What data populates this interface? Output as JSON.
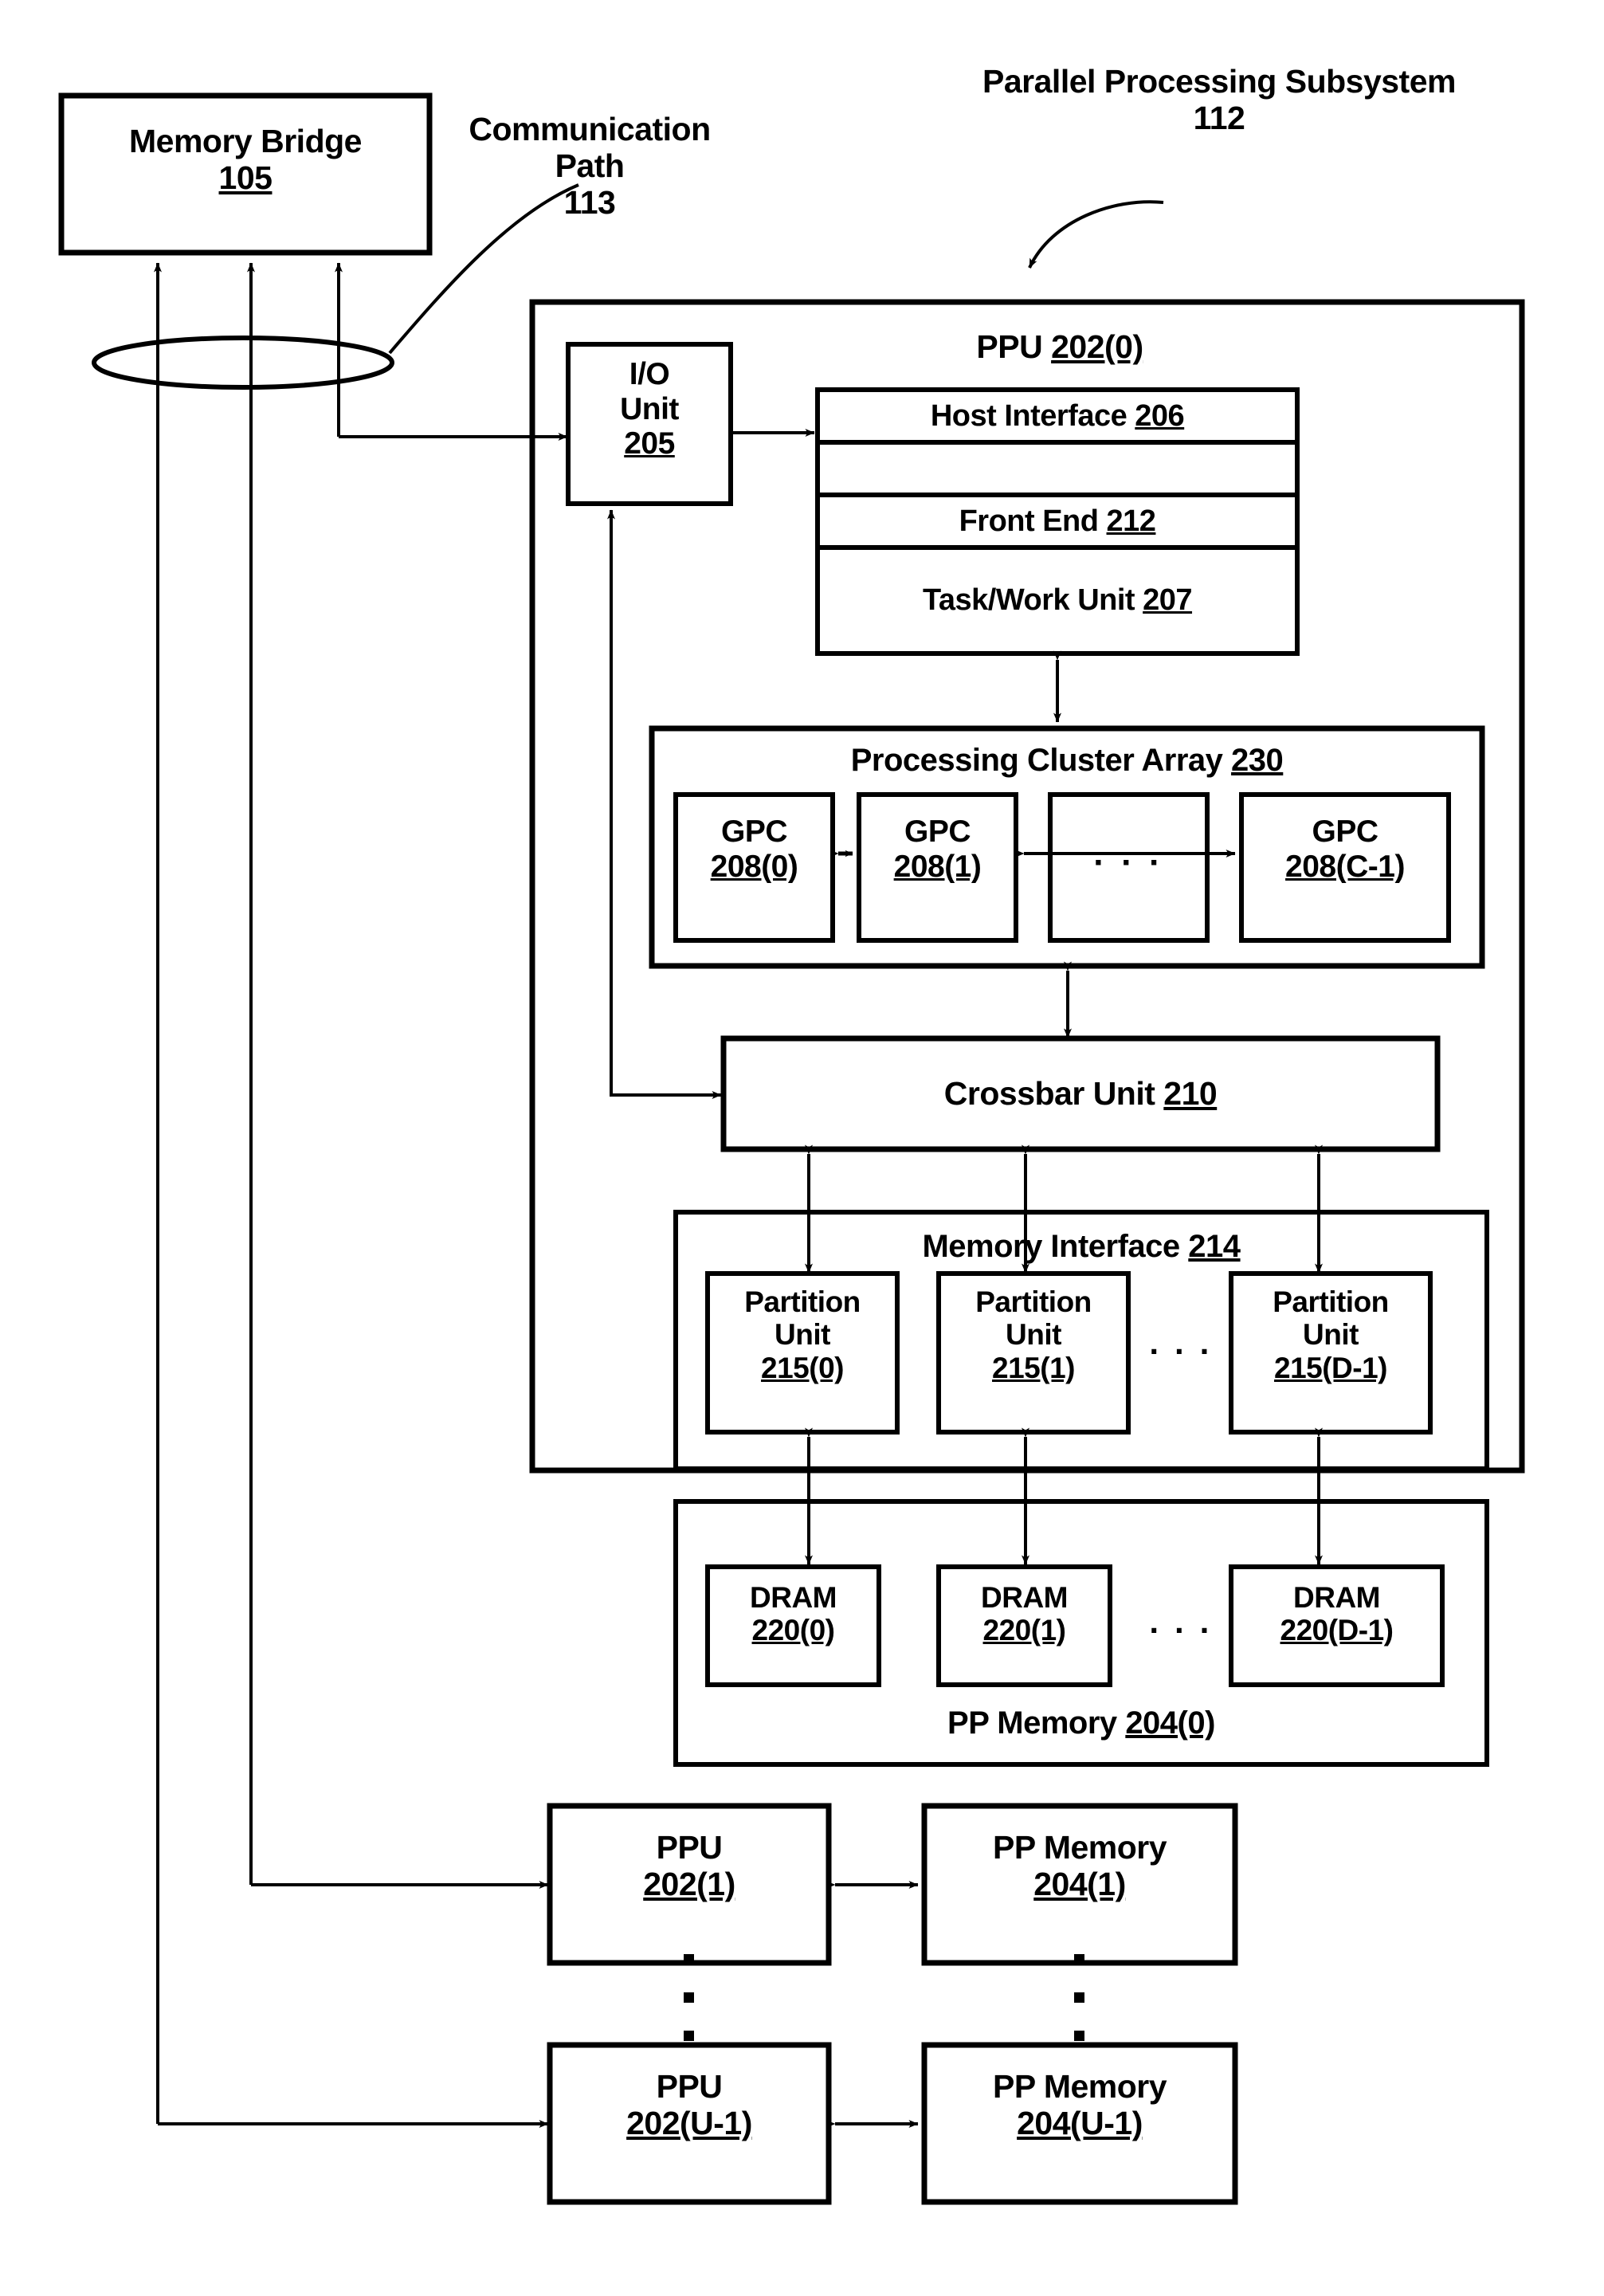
{
  "figure": {
    "title": "Parallel Processing Subsystem block diagram",
    "annotations": {
      "communication_path": {
        "name": "Communication Path",
        "ref": "113"
      },
      "parallel_processing_subsystem": {
        "name": "Parallel Processing Subsystem",
        "ref": "112"
      }
    }
  },
  "memory_bridge": {
    "name": "Memory Bridge",
    "ref": "105"
  },
  "ppu0": {
    "label_name": "PPU",
    "label_ref": "202(0)",
    "io_unit": {
      "line1": "I/O",
      "line2": "Unit",
      "ref": "205"
    },
    "host_stack": [
      {
        "name": "Host Interface",
        "ref": "206"
      },
      {
        "name": "Front End",
        "ref": "212"
      },
      {
        "name": "Task/Work Unit",
        "ref": "207"
      }
    ],
    "processing_cluster_array": {
      "name": "Processing Cluster Array",
      "ref": "230",
      "ellipsis": "· · ·",
      "gpcs": [
        {
          "name": "GPC",
          "ref": "208(0)"
        },
        {
          "name": "GPC",
          "ref": "208(1)"
        },
        {
          "name": "GPC",
          "ref": "208(C-1)"
        }
      ]
    },
    "crossbar_unit": {
      "name": "Crossbar Unit",
      "ref": "210"
    },
    "memory_interface": {
      "name": "Memory Interface",
      "ref": "214",
      "ellipsis": "· · ·",
      "partition_units": [
        {
          "line1": "Partition",
          "line2": "Unit",
          "ref": "215(0)"
        },
        {
          "line1": "Partition",
          "line2": "Unit",
          "ref": "215(1)"
        },
        {
          "line1": "Partition",
          "line2": "Unit",
          "ref": "215(D-1)"
        }
      ]
    }
  },
  "pp_memory0": {
    "name": "PP Memory",
    "ref": "204(0)",
    "ellipsis": "· · ·",
    "drams": [
      {
        "name": "DRAM",
        "ref": "220(0)"
      },
      {
        "name": "DRAM",
        "ref": "220(1)"
      },
      {
        "name": "DRAM",
        "ref": "220(D-1)"
      }
    ]
  },
  "additional_ppus": [
    {
      "ppu_name": "PPU",
      "ppu_ref": "202(1)",
      "mem_name": "PP Memory",
      "mem_ref": "204(1)"
    },
    {
      "ppu_name": "PPU",
      "ppu_ref": "202(U-1)",
      "mem_name": "PP Memory",
      "mem_ref": "204(U-1)"
    }
  ],
  "vertical_ellipsis": "⋮",
  "colors": {
    "stroke": "#000000",
    "fill": "#ffffff"
  }
}
